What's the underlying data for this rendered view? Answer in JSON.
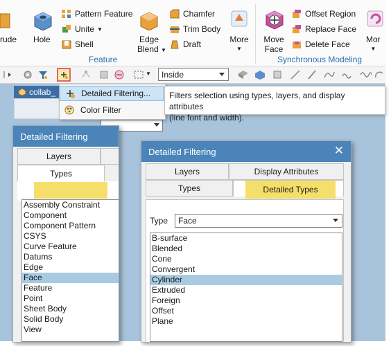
{
  "ribbon": {
    "feature_group": {
      "extrude_label": "rude",
      "hole_label": "Hole",
      "pattern_feature": "Pattern Feature",
      "unite": "Unite",
      "shell": "Shell",
      "edge_blend_line1": "Edge",
      "edge_blend_line2": "Blend",
      "chamfer": "Chamfer",
      "trim_body": "Trim Body",
      "draft": "Draft",
      "more": "More",
      "group_label": "Feature"
    },
    "sync_group": {
      "move_face_line1": "Move",
      "move_face_line2": "Face",
      "offset_region": "Offset Region",
      "replace_face": "Replace Face",
      "delete_face": "Delete Face",
      "more": "Mor",
      "group_label": "Synchronous Modeling"
    }
  },
  "toolbar": {
    "selection_scope": "Inside"
  },
  "nav": {
    "tab_label": "collab_"
  },
  "context_menu": {
    "items": [
      {
        "label": "Detailed Filtering..."
      },
      {
        "label": "Color Filter"
      }
    ]
  },
  "tooltip": {
    "line1": "Filters selection using types, layers, and display attributes",
    "line2": "(line font and width)."
  },
  "dialog_left": {
    "title": "Detailed Filtering",
    "tabs": {
      "layers": "Layers",
      "types": "Types"
    },
    "types_list": [
      "Assembly Constraint",
      "Component",
      "Component Pattern",
      "CSYS",
      "Curve Feature",
      "Datums",
      "Edge",
      "Face",
      "Feature",
      "Point",
      "Sheet Body",
      "Solid Body",
      "View"
    ],
    "selected_index": 7
  },
  "dialog_right": {
    "title": "Detailed Filtering",
    "tabs": {
      "layers": "Layers",
      "display_attributes": "Display Attributes",
      "types": "Types",
      "detailed_types": "Detailed Types"
    },
    "type_label": "Type",
    "type_value": "Face",
    "list": [
      "B-surface",
      "Blended",
      "Cone",
      "Convergent",
      "Cylinder",
      "Extruded",
      "Foreign",
      "Offset",
      "Plane"
    ],
    "selected_index": 4
  },
  "colors": {
    "title_bar": "#4a84b9",
    "highlight": "#f5df6b",
    "selection": "#a9cbe2",
    "background": "#a8c3dc",
    "group_label": "#2a6fb5"
  }
}
